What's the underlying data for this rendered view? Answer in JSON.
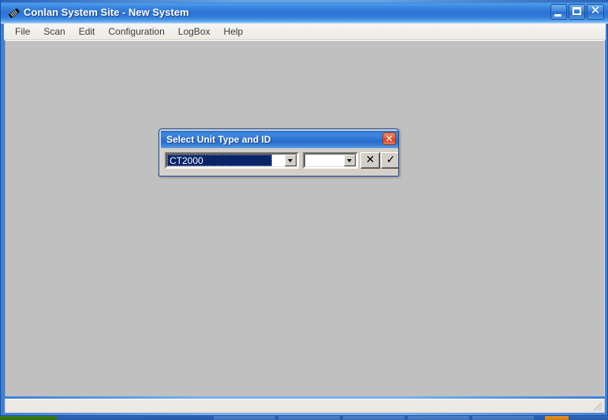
{
  "window": {
    "title": "Conlan System Site - New System",
    "icon": "module-icon",
    "controls": {
      "minimize": "_",
      "maximize": "□",
      "close": "✕"
    }
  },
  "menu": {
    "items": [
      {
        "label": "File",
        "name": "menu-item-file"
      },
      {
        "label": "Scan",
        "name": "menu-item-scan"
      },
      {
        "label": "Edit",
        "name": "menu-item-edit"
      },
      {
        "label": "Configuration",
        "name": "menu-item-configuration"
      },
      {
        "label": "LogBox",
        "name": "menu-item-logbox"
      },
      {
        "label": "Help",
        "name": "menu-item-help"
      }
    ]
  },
  "client": {
    "background_color": "#c0c0c0",
    "content": ""
  },
  "status_bar": {
    "text": "",
    "resize_grip": "resize-grip-icon"
  },
  "dialog": {
    "title": "Select Unit Type and ID",
    "close_label": "✕",
    "unit_type": {
      "value": "CT2000",
      "placeholder": "",
      "options": [
        "CT2000"
      ],
      "selected": true,
      "focused": true
    },
    "unit_id": {
      "value": "",
      "placeholder": "",
      "options": []
    },
    "buttons": {
      "cancel_label": "✕",
      "accept_label": "✓"
    }
  },
  "colors": {
    "title_bar_blue": "#2c74d6",
    "dialog_title_blue": "#2f76d4",
    "selection_navy": "#0a246a",
    "client_gray": "#c0c0c0",
    "dialog_face": "#d4d0c8",
    "close_red": "#cf4322"
  }
}
